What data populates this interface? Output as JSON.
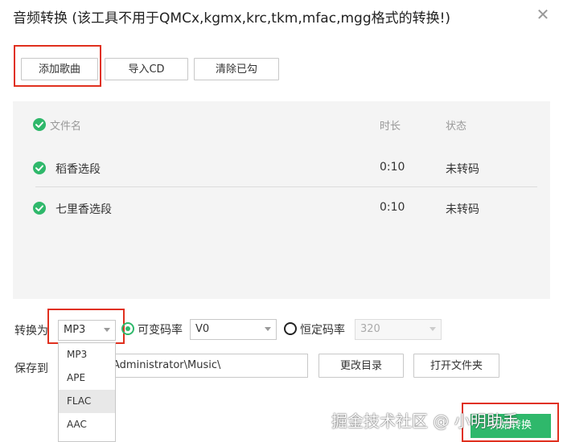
{
  "window": {
    "title": "音频转换 (该工具不用于QMCx,kgmx,krc,tkm,mfac,mgg格式的转换!)",
    "close_glyph": "✕",
    "close_icon": "close-icon"
  },
  "toolbar": {
    "add_song": "添加歌曲",
    "import_cd": "导入CD",
    "clear_checked": "清除已勾"
  },
  "list": {
    "columns": {
      "name": "文件名",
      "duration": "时长",
      "status": "状态"
    },
    "rows": [
      {
        "name": "稻香选段",
        "duration": "0:10",
        "status": "未转码",
        "checked": true
      },
      {
        "name": "七里香选段",
        "duration": "0:10",
        "status": "未转码",
        "checked": true
      }
    ]
  },
  "convert": {
    "label": "转换为",
    "format": "MP3",
    "vbr_label": "可变码率",
    "vbr_value": "V0",
    "vbr_selected": true,
    "cbr_label": "恒定码率",
    "cbr_value": "320"
  },
  "format_options": [
    "MP3",
    "APE",
    "FLAC",
    "AAC"
  ],
  "save": {
    "label": "保存到",
    "path": "Administrator\\Music\\",
    "change_dir": "更改目录",
    "open_folder": "打开文件夹"
  },
  "start_button": "开始转换",
  "watermark": "掘金技术社区 @ 小明助手",
  "colors": {
    "accent": "#2fb86b",
    "highlight": "#e0301e"
  }
}
